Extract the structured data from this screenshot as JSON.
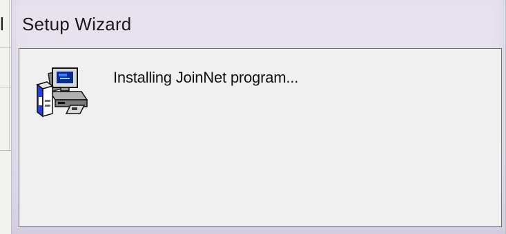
{
  "background": {
    "title_fragment": "l"
  },
  "window": {
    "title": "Setup Wizard",
    "status_text": "Installing JoinNet program...",
    "icon": "setup-installer-icon"
  },
  "colors": {
    "title_bar": "#e9e3ef",
    "client_area": "#f0f0f0",
    "text": "#111111"
  }
}
